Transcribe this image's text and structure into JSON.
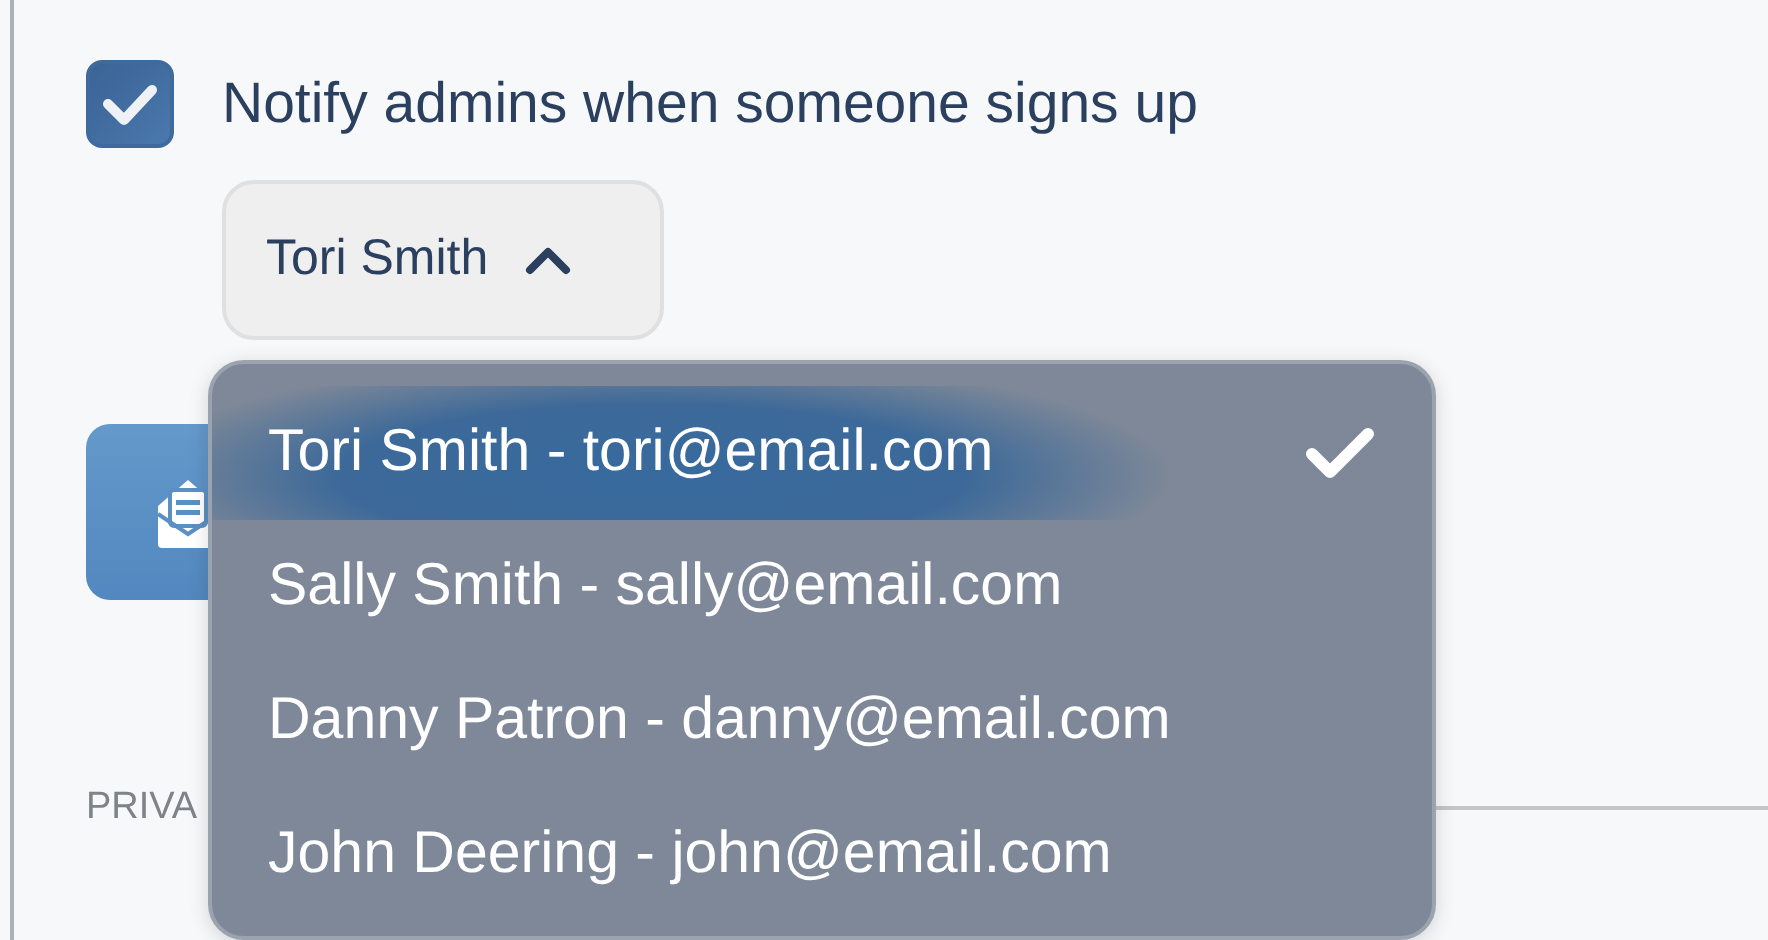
{
  "notify": {
    "label": "Notify admins when someone signs up",
    "checked": true
  },
  "admin_select": {
    "value": "Tori Smith",
    "expanded": true,
    "options": [
      {
        "label": "Tori Smith - tori@email.com",
        "selected": true
      },
      {
        "label": "Sally Smith - sally@email.com",
        "selected": false
      },
      {
        "label": "Danny Patron - danny@email.com",
        "selected": false
      },
      {
        "label": "John Deering - john@email.com",
        "selected": false
      }
    ]
  },
  "section_heading": "PRIVA"
}
